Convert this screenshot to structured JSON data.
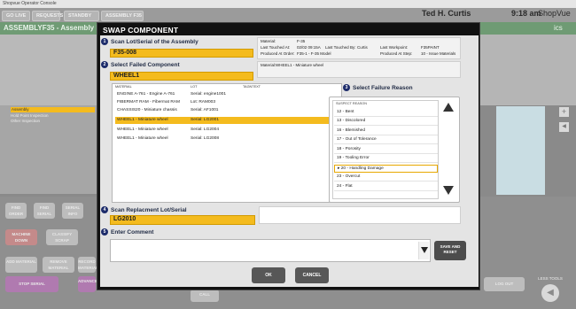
{
  "window": {
    "title": "Shopvue Operator Console"
  },
  "appbar": {
    "buttons": [
      "GO LIVE",
      "REQUESTS",
      "STANDBY",
      "ASSEMBLY F35"
    ],
    "user": "Ted H. Curtis",
    "time": "9:18 am",
    "brand": "ShopVue"
  },
  "background": {
    "header": "ASSEMBLYF35 - Assembly F",
    "right_header": "ics",
    "inspections": [
      "Assembly",
      "Hold Point Inspection",
      "Other Inspection"
    ],
    "buttons": [
      "FIND ORDER",
      "FIND SERIAL",
      "SERIAL INFO",
      "MACHINE DOWN",
      "CLASSIFY SCRAP",
      "ADD MATERIAL",
      "REMOVE MATERIAL",
      "RECORD MATERIAL",
      "STOP SERIAL",
      "ADVANCE",
      "CALL",
      "LOG OUT",
      "LESS TOOLS"
    ]
  },
  "dialog": {
    "title": "SWAP COMPONENT",
    "step1": {
      "num": "1",
      "label": "Scan Lot/Serial of the Assembly",
      "value": "F35-008"
    },
    "step2": {
      "num": "2",
      "label": "Select Failed Component",
      "value": "WHEEL1"
    },
    "info1": {
      "material_label": "Material:",
      "material_value": "F-35",
      "last_touched_at_label": "Last Touched At:",
      "last_touched_at_value": "02/02 09:15A",
      "last_touched_by_label": "Last Touched By:",
      "last_touched_by_value": "Curtis",
      "last_workpoint_label": "Last Workpoint:",
      "last_workpoint_value": "F35PAINT",
      "produced_order_label": "Produced At Order:",
      "produced_order_value": "F35-1 - F-35 Model",
      "produced_step_label": "Produced At Step:",
      "produced_step_value": "10 - Issue Materials"
    },
    "info2": {
      "material_label": "Material:",
      "material_value": "WHEEL1 - Miniature wheel"
    },
    "table": {
      "headers": [
        "MATERIAL",
        "LOT",
        "TAGNTEXT"
      ],
      "rows": [
        {
          "material": "ENGINE A-761 - Engine A-761",
          "lot": "Serial: engine1001"
        },
        {
          "material": "FIBERMAT RAM - Fibermat RAM",
          "lot": "Lot: RAM003"
        },
        {
          "material": "CHASSIS20 - Miniature chassis",
          "lot": "Serial: AF1001"
        },
        {
          "material": "WHEEL1 - Miniature wheel",
          "lot": "Serial: LG2001"
        },
        {
          "material": "WHEEL1 - Miniature wheel",
          "lot": "Serial: LG2004"
        },
        {
          "material": "WHEEL1 - Miniature wheel",
          "lot": "Serial: LG2008"
        }
      ]
    },
    "step3": {
      "num": "3",
      "label": "Select Failure Reason",
      "header": "SUSPECT REASON",
      "reasons": [
        "12 - Bent",
        "13 - Discolored",
        "16 - Blemished",
        "17 - Out of Tolerance",
        "18 - Porosity",
        "19 - Tooling Error",
        "20 - Handling Damage",
        "23 - Overcut",
        "24 - Flat"
      ]
    },
    "step4": {
      "num": "4",
      "label": "Scan Replacment Lot/Serial",
      "value": "LG2010"
    },
    "step5": {
      "num": "5",
      "label": "Enter Comment"
    },
    "save_reset": "SAVE AND RESET",
    "ok": "OK",
    "cancel": "CANCEL"
  }
}
